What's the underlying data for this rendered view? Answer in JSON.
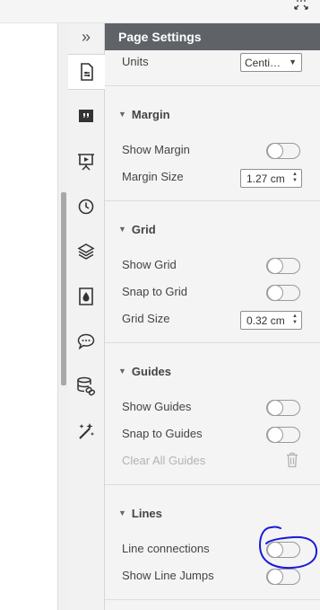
{
  "panel": {
    "title": "Page Settings",
    "collapse_glyph": "»"
  },
  "rail": {
    "items": [
      {
        "icon": "page-settings-icon",
        "active": true
      },
      {
        "icon": "quote-icon"
      },
      {
        "icon": "presentation-icon"
      },
      {
        "icon": "history-clock-icon"
      },
      {
        "icon": "layers-icon"
      },
      {
        "icon": "theme-drop-icon"
      },
      {
        "icon": "comment-icon"
      },
      {
        "icon": "data-link-icon"
      },
      {
        "icon": "magic-wand-icon"
      }
    ]
  },
  "units": {
    "label": "Units",
    "value": "Centi…",
    "arrow": "▼"
  },
  "margin": {
    "title": "Margin",
    "show_label": "Show Margin",
    "show_on": false,
    "size_label": "Margin Size",
    "size_value": "1.27 cm"
  },
  "grid": {
    "title": "Grid",
    "show_label": "Show Grid",
    "show_on": false,
    "snap_label": "Snap to Grid",
    "snap_on": false,
    "size_label": "Grid Size",
    "size_value": "0.32 cm"
  },
  "guides": {
    "title": "Guides",
    "show_label": "Show Guides",
    "show_on": false,
    "snap_label": "Snap to Guides",
    "snap_on": false,
    "clear_label": "Clear All Guides"
  },
  "lines": {
    "title": "Lines",
    "connections_label": "Line connections",
    "connections_on": false,
    "jumps_label": "Show Line Jumps",
    "jumps_on": false
  },
  "glyphs": {
    "caret": "▼",
    "stepper_up": "▲",
    "stepper_down": "▼"
  },
  "colors": {
    "header_bg": "#5f6368",
    "annotation": "#1a1adb"
  }
}
